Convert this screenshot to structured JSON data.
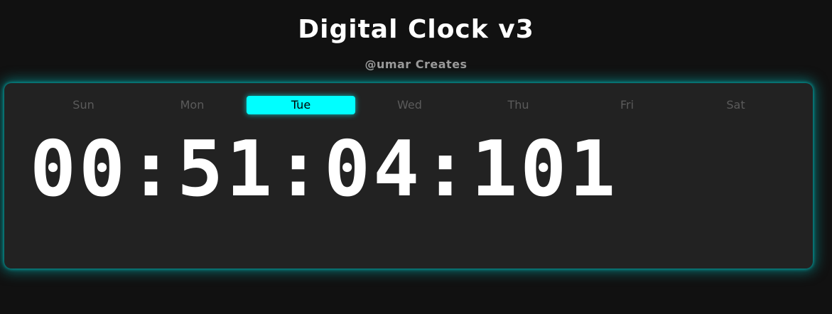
{
  "header": {
    "title": "Digital Clock v3",
    "subtitle": "@umar Creates"
  },
  "clock": {
    "days": [
      "Sun",
      "Mon",
      "Tue",
      "Wed",
      "Thu",
      "Fri",
      "Sat"
    ],
    "active_day_index": 2,
    "time": "00:51:04:101"
  },
  "colors": {
    "background": "#111111",
    "panel": "#222222",
    "accent": "#00ffff",
    "glow": "#00b4b4",
    "inactive_day": "#5b5b5b",
    "time_text": "#ffffff"
  }
}
